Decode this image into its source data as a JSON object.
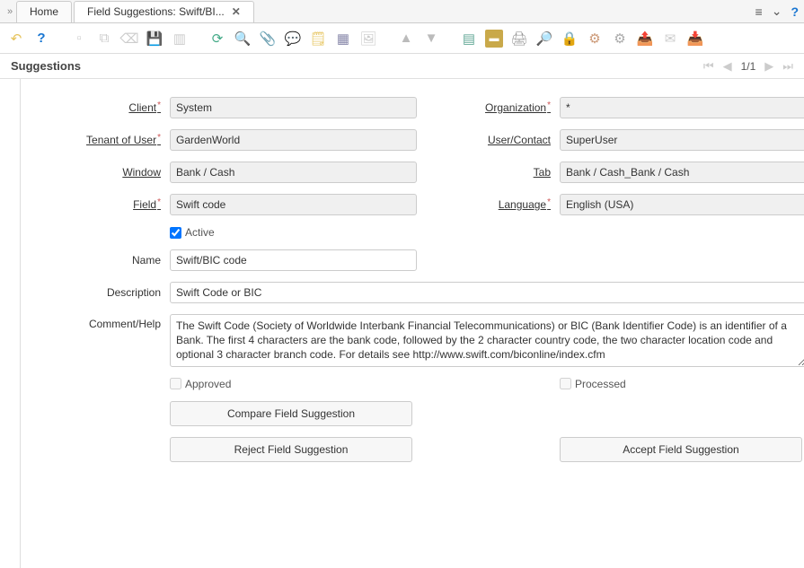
{
  "tabs": {
    "home": "Home",
    "active": "Field Suggestions: Swift/BI..."
  },
  "subheader": {
    "title": "Suggestions",
    "pager": "1/1"
  },
  "form": {
    "client_label": "Client",
    "client_value": "System",
    "organization_label": "Organization",
    "organization_value": "*",
    "tenant_label": "Tenant of User",
    "tenant_value": "GardenWorld",
    "usercontact_label": "User/Contact",
    "usercontact_value": "SuperUser",
    "window_label": "Window",
    "window_value": "Bank / Cash",
    "tab_label": "Tab",
    "tab_value": "Bank / Cash_Bank / Cash",
    "field_label": "Field",
    "field_value": "Swift code",
    "language_label": "Language",
    "language_value": "English (USA)",
    "active_label": "Active",
    "name_label": "Name",
    "name_value": "Swift/BIC code",
    "description_label": "Description",
    "description_value": "Swift Code or BIC",
    "comment_label": "Comment/Help",
    "comment_value": "The Swift Code (Society of Worldwide Interbank Financial Telecommunications) or BIC (Bank Identifier Code) is an identifier of a Bank. The first 4 characters are the bank code, followed by the 2 character country code, the two character location code and optional 3 character branch code. For details see http://www.swift.com/biconline/index.cfm",
    "approved_label": "Approved",
    "processed_label": "Processed"
  },
  "buttons": {
    "compare": "Compare Field Suggestion",
    "reject": "Reject Field Suggestion",
    "accept": "Accept Field Suggestion"
  }
}
